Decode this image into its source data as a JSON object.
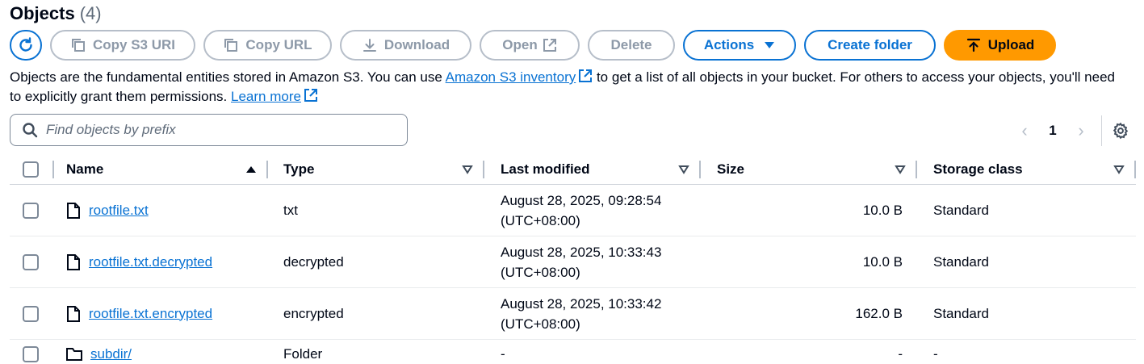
{
  "header": {
    "title": "Objects",
    "count": "(4)"
  },
  "toolbar": {
    "copy_s3_uri": "Copy S3 URI",
    "copy_url": "Copy URL",
    "download": "Download",
    "open": "Open",
    "delete": "Delete",
    "actions": "Actions",
    "create_folder": "Create folder",
    "upload": "Upload"
  },
  "description": {
    "part1": "Objects are the fundamental entities stored in Amazon S3. You can use ",
    "inventory_link": "Amazon S3 inventory",
    "part2": " to get a list of all objects in your bucket. For others to access your objects, you'll need to explicitly grant them permissions. ",
    "learn_more": "Learn more"
  },
  "search": {
    "placeholder": "Find objects by prefix"
  },
  "pagination": {
    "current_page": "1"
  },
  "table": {
    "columns": [
      "Name",
      "Type",
      "Last modified",
      "Size",
      "Storage class"
    ],
    "rows": [
      {
        "name": "rootfile.txt",
        "type": "txt",
        "modified_line1": "August 28, 2025, 09:28:54",
        "modified_line2": "(UTC+08:00)",
        "size": "10.0 B",
        "storage": "Standard",
        "icon": "file-icon"
      },
      {
        "name": "rootfile.txt.decrypted",
        "type": "decrypted",
        "modified_line1": "August 28, 2025, 10:33:43",
        "modified_line2": "(UTC+08:00)",
        "size": "10.0 B",
        "storage": "Standard",
        "icon": "file-icon"
      },
      {
        "name": "rootfile.txt.encrypted",
        "type": "encrypted",
        "modified_line1": "August 28, 2025, 10:33:42",
        "modified_line2": "(UTC+08:00)",
        "size": "162.0 B",
        "storage": "Standard",
        "icon": "file-icon"
      },
      {
        "name": "subdir/",
        "type": "Folder",
        "modified_line1": "-",
        "modified_line2": "",
        "size": "-",
        "storage": "-",
        "icon": "folder-icon"
      }
    ]
  },
  "colors": {
    "accent": "#0972d3",
    "upload": "#ff9900",
    "disabled": "#8d99a8"
  }
}
